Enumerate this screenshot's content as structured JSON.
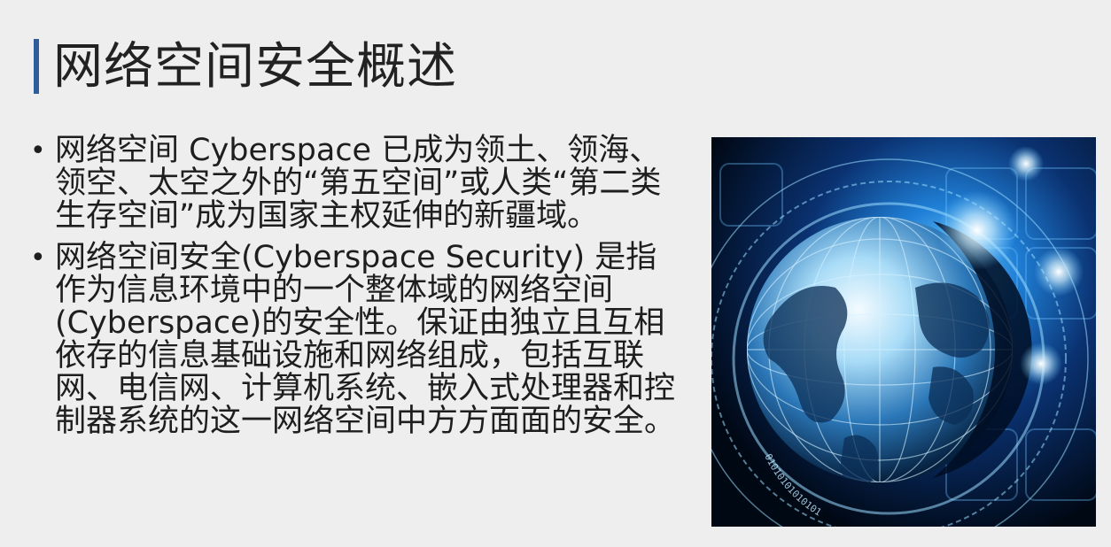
{
  "slide": {
    "title": "网络空间安全概述",
    "bullets": [
      {
        "text": " 网络空间 Cyberspace 已成为领土、领海、领空、太空之外的“第五空间”或人类“第二类生存空间”成为国家主权延伸的新疆域。"
      },
      {
        "text": "网络空间安全(Cyberspace Security) 是指作为信息环境中的一个整体域的网络空间(Cyberspace)的安全性。保证由独立且互相依存的信息基础设施和网络组成，包括互联网、电信网、计算机系统、嵌入式处理器和控制器系统的这一网络空间中方方面面的安全。"
      }
    ],
    "bullet_symbol": "•",
    "image": {
      "icon": "cyber-globe-illustration",
      "binary_text": "01010101010101"
    }
  },
  "colors": {
    "background": "#eeeeee",
    "title_accent": "#2f5d9c",
    "text": "#1e1e1e"
  }
}
